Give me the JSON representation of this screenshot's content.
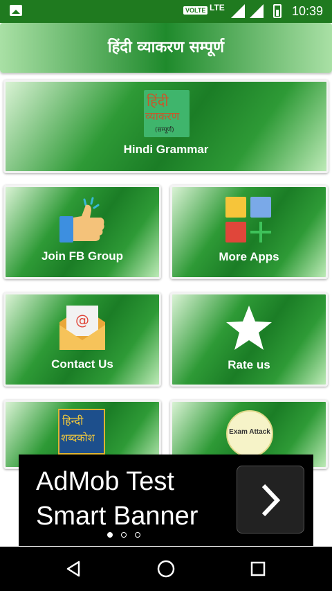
{
  "status_bar": {
    "volte": "VOLTE",
    "network": "LTE",
    "time": "10:39",
    "icons": [
      "image-icon",
      "signal-icon",
      "signal-icon",
      "battery-icon"
    ]
  },
  "header": {
    "title": "हिंदी व्याकरण सम्पूर्ण"
  },
  "cards": {
    "grammar": {
      "label": "Hindi Grammar",
      "logo_line1": "हिंदी",
      "logo_line2": "व्याकरण",
      "logo_line3": "(सम्पूर्ण)",
      "icon": "book-logo-icon"
    },
    "fb_group": {
      "label": "Join FB Group",
      "icon": "thumbs-up-icon"
    },
    "more_apps": {
      "label": "More Apps",
      "icon": "apps-grid-icon"
    },
    "contact": {
      "label": "Contact Us",
      "icon": "email-envelope-icon"
    },
    "rate": {
      "label": "Rate us",
      "icon": "star-icon"
    },
    "dictionary": {
      "logo_line1": "हिन्दी",
      "logo_line2": "शब्दकोश",
      "icon": "dictionary-logo-icon"
    },
    "exam": {
      "logo_text": "Exam Attack",
      "icon": "exam-attack-logo-icon"
    }
  },
  "ad": {
    "line1": "AdMob Test",
    "line2": "Smart Banner",
    "icon": "chevron-right-icon"
  },
  "nav": {
    "icons": [
      "back-icon",
      "home-icon",
      "recents-icon"
    ]
  },
  "colors": {
    "status_bar": "#1f7a1f",
    "card_green": "#1b7d26",
    "card_light": "#bdeab7",
    "ad_bg": "#000000"
  }
}
